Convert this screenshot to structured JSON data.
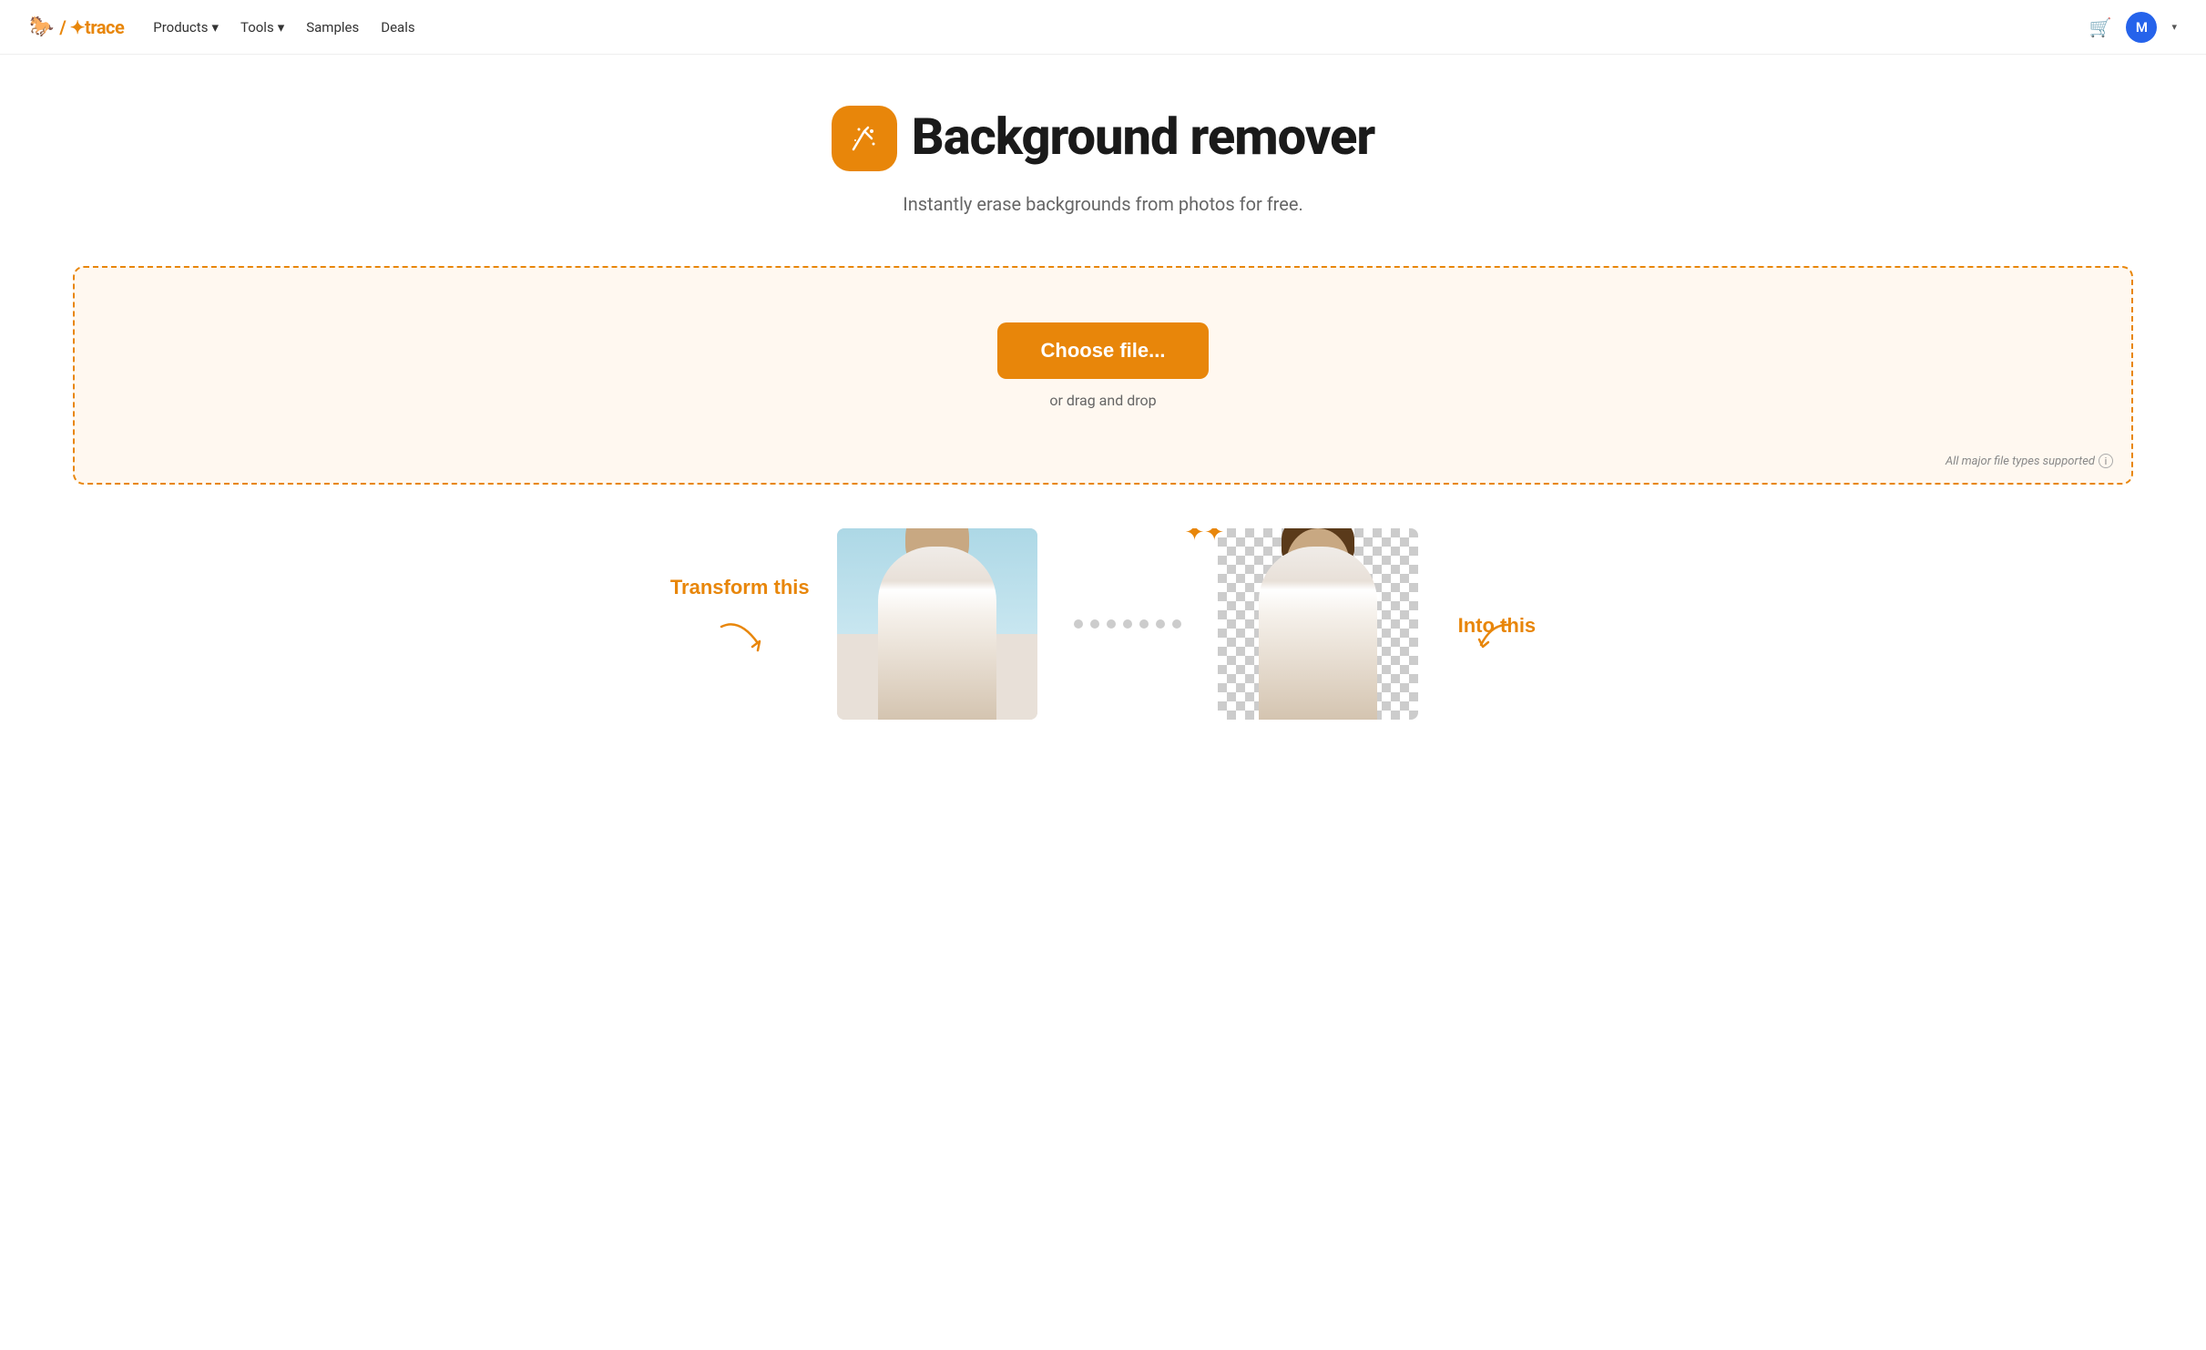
{
  "nav": {
    "logo_text": "trace",
    "links": [
      {
        "label": "Products",
        "has_dropdown": true
      },
      {
        "label": "Tools",
        "has_dropdown": true
      },
      {
        "label": "Samples",
        "has_dropdown": false
      },
      {
        "label": "Deals",
        "has_dropdown": false
      }
    ],
    "user_initial": "M"
  },
  "hero": {
    "title": "Background remover",
    "subtitle": "Instantly erase backgrounds from photos for free."
  },
  "upload": {
    "choose_label": "Choose file...",
    "drag_drop_label": "or drag and drop",
    "file_types_note": "All major file types supported"
  },
  "demo": {
    "transform_label": "Transform this",
    "into_label": "Into this"
  },
  "colors": {
    "brand_orange": "#E8860A"
  }
}
